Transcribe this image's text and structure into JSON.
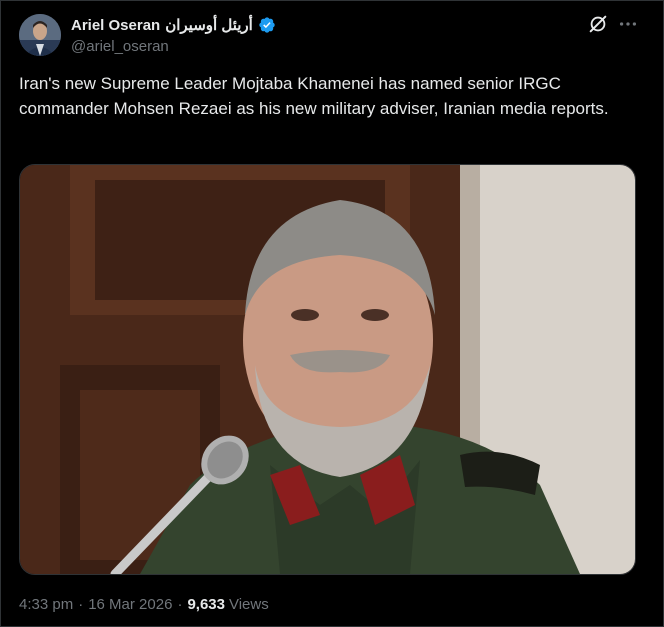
{
  "author": {
    "name": "Ariel Oseran",
    "name_arabic": "أريئل أوسيران",
    "handle": "@ariel_oseran",
    "verified_color": "#1d9bf0"
  },
  "icons": {
    "grok": "grok-icon",
    "more": "more-horizontal-icon",
    "verified": "verified-badge-icon"
  },
  "tweet": {
    "text": "Iran's new Supreme Leader Mojtaba Khamenei has named senior IRGC commander Mohsen Rezaei as his new military adviser, Iranian media reports.",
    "media_alt": "Photo of a gray-bearded man in an IRGC military uniform speaking at a microphone"
  },
  "meta": {
    "time": "4:33 pm",
    "separator": "·",
    "date": "16 Mar 2026",
    "views_count": "9,633",
    "views_label": "Views"
  },
  "colors": {
    "background": "#000000",
    "text": "#e7e9ea",
    "secondary": "#71767b",
    "accent": "#1d9bf0"
  }
}
